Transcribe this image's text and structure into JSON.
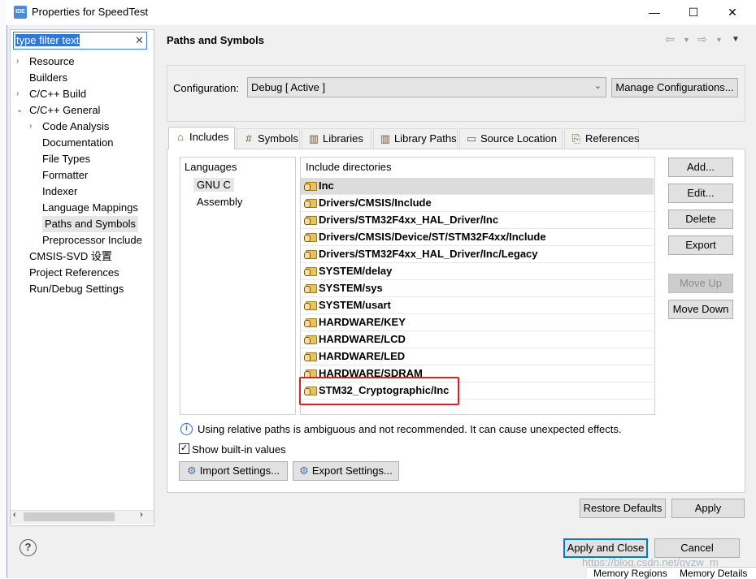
{
  "window": {
    "title": "Properties for SpeedTest",
    "app_icon_text": "IDE"
  },
  "filter": {
    "value": "type filter text"
  },
  "tree": [
    {
      "label": "Resource",
      "indent": 0,
      "arrow": "›"
    },
    {
      "label": "Builders",
      "indent": 0,
      "arrow": ""
    },
    {
      "label": "C/C++ Build",
      "indent": 0,
      "arrow": "›"
    },
    {
      "label": "C/C++ General",
      "indent": 0,
      "arrow": "⌄"
    },
    {
      "label": "Code Analysis",
      "indent": 1,
      "arrow": "›"
    },
    {
      "label": "Documentation",
      "indent": 1,
      "arrow": ""
    },
    {
      "label": "File Types",
      "indent": 1,
      "arrow": ""
    },
    {
      "label": "Formatter",
      "indent": 1,
      "arrow": ""
    },
    {
      "label": "Indexer",
      "indent": 1,
      "arrow": ""
    },
    {
      "label": "Language Mappings",
      "indent": 1,
      "arrow": ""
    },
    {
      "label": "Paths and Symbols",
      "indent": 1,
      "arrow": "",
      "selected": true
    },
    {
      "label": "Preprocessor Include",
      "indent": 1,
      "arrow": ""
    },
    {
      "label": "CMSIS-SVD 设置",
      "indent": 0,
      "arrow": ""
    },
    {
      "label": "Project References",
      "indent": 0,
      "arrow": ""
    },
    {
      "label": "Run/Debug Settings",
      "indent": 0,
      "arrow": ""
    }
  ],
  "page": {
    "title": "Paths and Symbols"
  },
  "configuration": {
    "label": "Configuration:",
    "value": "Debug  [ Active ]",
    "manage_button": "Manage Configurations..."
  },
  "tabs": [
    {
      "label": "Includes",
      "icon": "includes-icon",
      "glyph": "⌂"
    },
    {
      "label": "Symbols",
      "icon": "symbols-icon",
      "glyph": "#"
    },
    {
      "label": "Libraries",
      "icon": "libraries-icon",
      "glyph": "▥"
    },
    {
      "label": "Library Paths",
      "icon": "library-paths-icon",
      "glyph": "▥"
    },
    {
      "label": "Source Location",
      "icon": "source-location-icon",
      "glyph": "▭"
    },
    {
      "label": "References",
      "icon": "references-icon",
      "glyph": "⎘"
    }
  ],
  "languages": {
    "header": "Languages",
    "items": [
      "GNU C",
      "Assembly"
    ]
  },
  "includes": {
    "header": "Include directories",
    "items": [
      "Inc",
      "Drivers/CMSIS/Include",
      "Drivers/STM32F4xx_HAL_Driver/Inc",
      "Drivers/CMSIS/Device/ST/STM32F4xx/Include",
      "Drivers/STM32F4xx_HAL_Driver/Inc/Legacy",
      "SYSTEM/delay",
      "SYSTEM/sys",
      "SYSTEM/usart",
      "HARDWARE/KEY",
      "HARDWARE/LCD",
      "HARDWARE/LED",
      "HARDWARE/SDRAM",
      "STM32_Cryptographic/Inc"
    ]
  },
  "side_buttons": {
    "add": "Add...",
    "edit": "Edit...",
    "delete": "Delete",
    "export": "Export",
    "move_up": "Move Up",
    "move_down": "Move Down"
  },
  "info": {
    "text": "Using relative paths is ambiguous and not recommended. It can cause unexpected effects."
  },
  "show_builtin": {
    "label": "Show built-in values",
    "checked": "✓"
  },
  "settings_buttons": {
    "import": "Import Settings...",
    "export": "Export Settings..."
  },
  "footer": {
    "restore_defaults": "Restore Defaults",
    "apply": "Apply",
    "apply_and_close": "Apply and Close",
    "cancel": "Cancel"
  },
  "watermark": "https://blog.csdn.net/gyzw_m",
  "background_tabs": [
    "Memory Regions",
    "Memory Details"
  ],
  "colors": {
    "highlight": "#e02020",
    "accent": "#0078d7"
  }
}
